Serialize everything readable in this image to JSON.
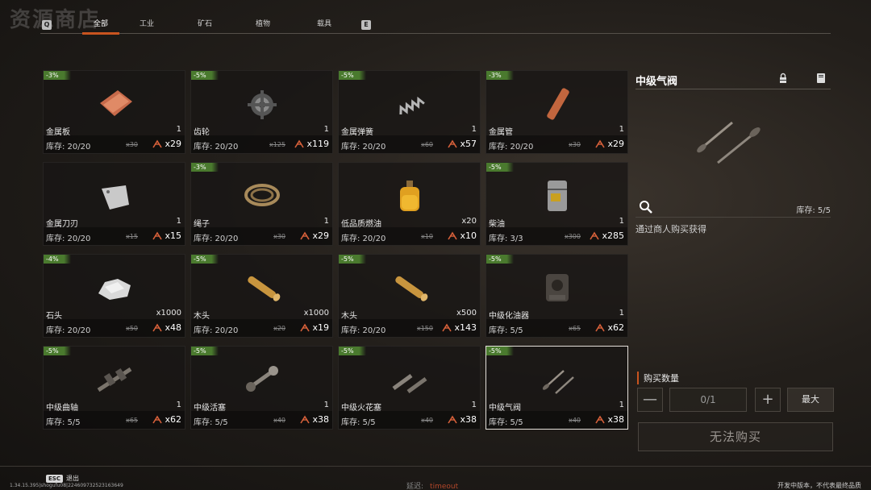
{
  "shop_title": "资源商店",
  "tabs": {
    "left_key": "Q",
    "right_key": "E",
    "items": [
      {
        "label": "全部",
        "active": true
      },
      {
        "label": "工业",
        "active": false
      },
      {
        "label": "矿石",
        "active": false
      },
      {
        "label": "植物",
        "active": false
      },
      {
        "label": "载具",
        "active": false
      }
    ]
  },
  "items": [
    {
      "discount": "-3%",
      "name": "金属板",
      "qty": "1",
      "stock": "库存: 20/20",
      "old_price": "x30",
      "price": "x29",
      "icon": "metal-sheet-icon"
    },
    {
      "discount": "-5%",
      "name": "齿轮",
      "qty": "1",
      "stock": "库存: 20/20",
      "old_price": "x125",
      "price": "x119",
      "icon": "gear-icon"
    },
    {
      "discount": "-5%",
      "name": "金属弹簧",
      "qty": "1",
      "stock": "库存: 20/20",
      "old_price": "x60",
      "price": "x57",
      "icon": "spring-icon"
    },
    {
      "discount": "-3%",
      "name": "金属管",
      "qty": "1",
      "stock": "库存: 20/20",
      "old_price": "x30",
      "price": "x29",
      "icon": "metal-pipe-icon"
    },
    {
      "discount": "",
      "name": "金属刀刃",
      "qty": "1",
      "stock": "库存: 20/20",
      "old_price": "x15",
      "price": "x15",
      "icon": "metal-blade-icon"
    },
    {
      "discount": "-3%",
      "name": "绳子",
      "qty": "1",
      "stock": "库存: 20/20",
      "old_price": "x30",
      "price": "x29",
      "icon": "rope-icon"
    },
    {
      "discount": "",
      "name": "低品质燃油",
      "qty": "x20",
      "stock": "库存: 20/20",
      "old_price": "x10",
      "price": "x10",
      "icon": "fuel-bottle-icon"
    },
    {
      "discount": "-5%",
      "name": "柴油",
      "qty": "1",
      "stock": "库存: 3/3",
      "old_price": "x300",
      "price": "x285",
      "icon": "diesel-barrel-icon"
    },
    {
      "discount": "-4%",
      "name": "石头",
      "qty": "x1000",
      "stock": "库存: 20/20",
      "old_price": "x50",
      "price": "x48",
      "icon": "stone-icon"
    },
    {
      "discount": "-5%",
      "name": "木头",
      "qty": "x1000",
      "stock": "库存: 20/20",
      "old_price": "x20",
      "price": "x19",
      "icon": "wood-log-icon"
    },
    {
      "discount": "-5%",
      "name": "木头",
      "qty": "x500",
      "stock": "库存: 20/20",
      "old_price": "x150",
      "price": "x143",
      "icon": "wood-log-icon"
    },
    {
      "discount": "-5%",
      "name": "中级化油器",
      "qty": "1",
      "stock": "库存: 5/5",
      "old_price": "x65",
      "price": "x62",
      "icon": "carburetor-icon"
    },
    {
      "discount": "-5%",
      "name": "中级曲轴",
      "qty": "1",
      "stock": "库存: 5/5",
      "old_price": "x65",
      "price": "x62",
      "icon": "crankshaft-icon"
    },
    {
      "discount": "-5%",
      "name": "中级活塞",
      "qty": "1",
      "stock": "库存: 5/5",
      "old_price": "x40",
      "price": "x38",
      "icon": "piston-icon"
    },
    {
      "discount": "-5%",
      "name": "中级火花塞",
      "qty": "1",
      "stock": "库存: 5/5",
      "old_price": "x40",
      "price": "x38",
      "icon": "spark-plug-icon"
    },
    {
      "discount": "-5%",
      "name": "中级气阀",
      "qty": "1",
      "stock": "库存: 5/5",
      "old_price": "x40",
      "price": "x38",
      "icon": "valve-icon",
      "selected": true
    }
  ],
  "detail": {
    "title": "中级气阀",
    "stock": "库存: 5/5",
    "description": "通过商人购买获得",
    "icon": "valve-icon"
  },
  "purchase": {
    "label": "购买数量",
    "minus": "—",
    "quantity": "0/1",
    "plus": "+",
    "max": "最大",
    "buy": "无法购买"
  },
  "footer": {
    "esc_key": "ESC",
    "esc_label": "退出",
    "version": "1.34.15.395|shogufu08|224609732523163649",
    "latency_label": "延迟:",
    "latency_value": "timeout",
    "dev_note": "开发中版本，不代表最终品质"
  },
  "colors": {
    "accent": "#c9541f",
    "discount": "#4a7a2e"
  }
}
